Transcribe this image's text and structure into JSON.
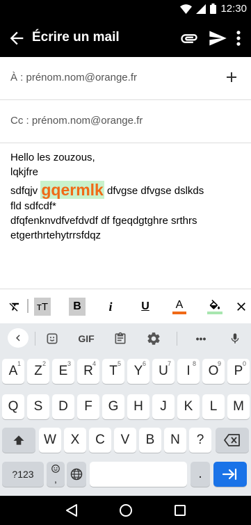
{
  "status_bar": {
    "time": "12:30",
    "wifi_icon": "wifi-icon",
    "signal_icon": "signal-icon",
    "battery_icon": "battery-icon"
  },
  "app_bar": {
    "title": "Écrire un mail",
    "back_icon": "back-arrow-icon",
    "attach_icon": "attachment-icon",
    "send_icon": "send-icon",
    "menu_icon": "more-vert-icon"
  },
  "to_field": {
    "label": "À : prénom.nom@orange.fr",
    "add_icon": "add-icon"
  },
  "cc_field": {
    "label": "Cc : prénom.nom@orange.fr"
  },
  "message": {
    "line1": "Hello les zouzous,",
    "line2": "lqkjfre",
    "line3_before": "sdfqjv ",
    "line3_big": "gqermlk",
    "line3_after": " dfvgse dfvgse dslkds",
    "line4": "fld sdfcdf*",
    "line5": "dfqfenknvdfvefdvdf df fgeqdgtghre srthrs",
    "line6": "etgerthrtehytrrsfdqz",
    "highlight_text_color": "#f06a17",
    "highlight_background": "#c9f2cc"
  },
  "format_toolbar": {
    "clear_format_icon": "clear-format-icon",
    "text_size_label": "тT",
    "bold_label": "B",
    "italic_label": "i",
    "underline_label": "U",
    "text_color_label": "A",
    "text_color": "#f06a17",
    "highlight_icon": "fill-bucket-icon",
    "highlight_color": "#a8e6b0",
    "close_icon": "close-icon"
  },
  "keyboard": {
    "toolbar": {
      "back_icon": "chevron-left-icon",
      "sticker_icon": "sticker-icon",
      "gif_label": "GIF",
      "clipboard_icon": "clipboard-icon",
      "settings_icon": "gear-icon",
      "more_label": "•••",
      "mic_icon": "mic-icon"
    },
    "row1": [
      {
        "k": "A",
        "h": "1"
      },
      {
        "k": "Z",
        "h": "2"
      },
      {
        "k": "E",
        "h": "3"
      },
      {
        "k": "R",
        "h": "4"
      },
      {
        "k": "T",
        "h": "5"
      },
      {
        "k": "Y",
        "h": "6"
      },
      {
        "k": "U",
        "h": "7"
      },
      {
        "k": "I",
        "h": "8"
      },
      {
        "k": "O",
        "h": "9"
      },
      {
        "k": "P",
        "h": "0"
      }
    ],
    "row2": [
      "Q",
      "S",
      "D",
      "F",
      "G",
      "H",
      "J",
      "K",
      "L",
      "M"
    ],
    "row3": [
      "W",
      "X",
      "C",
      "V",
      "B",
      "N",
      "?"
    ],
    "shift_icon": "shift-icon",
    "backspace_icon": "backspace-icon",
    "symbols_label": "?123",
    "emoji_comma_label": ",",
    "globe_icon": "globe-icon",
    "period_label": ".",
    "enter_icon": "enter-icon",
    "enter_color": "#1a73e8"
  },
  "nav_bar": {
    "back_icon": "nav-back-icon",
    "home_icon": "nav-home-icon",
    "recents_icon": "nav-recents-icon"
  }
}
